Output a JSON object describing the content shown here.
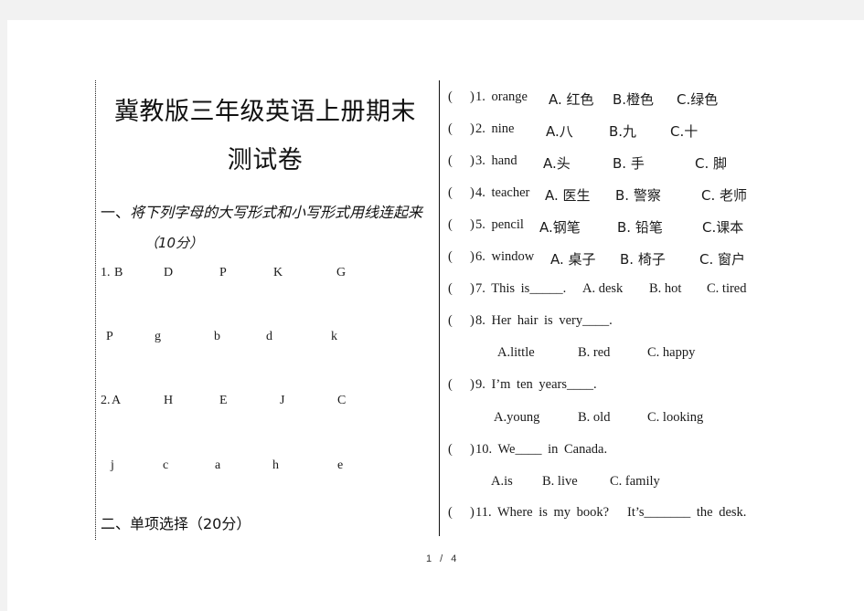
{
  "document": {
    "title_line1": "冀教版三年级英语上册期末",
    "title_line2": "测试卷",
    "section1": {
      "prefix": "一、",
      "instruction": "将下列字母的大写形式和小写形式用线连起来",
      "score": "（10分）",
      "rows": [
        {
          "label": "1.",
          "letters": [
            "B",
            "D",
            "P",
            "K",
            "G"
          ]
        },
        {
          "label": "",
          "letters": [
            "P",
            "g",
            "b",
            "d",
            "k"
          ]
        },
        {
          "label": "2.",
          "letters": [
            "A",
            "H",
            "E",
            "J",
            "C"
          ]
        },
        {
          "label": "",
          "letters": [
            "j",
            "c",
            "a",
            "h",
            "e"
          ]
        }
      ]
    },
    "section2": {
      "heading": "二、单项选择（20分）"
    },
    "questions": [
      {
        "num": "1.",
        "stem": "orange",
        "options": [
          "A. 红色",
          "B.橙色",
          "C.绿色"
        ]
      },
      {
        "num": "2.",
        "stem": "nine",
        "options": [
          "A.八",
          "B.九",
          "C.十"
        ]
      },
      {
        "num": "3.",
        "stem": "hand",
        "options": [
          "A.头",
          "B. 手",
          "C. 脚"
        ]
      },
      {
        "num": "4.",
        "stem": "teacher",
        "options": [
          "A. 医生",
          "B. 警察",
          "C. 老师"
        ]
      },
      {
        "num": "5.",
        "stem": "pencil",
        "options": [
          "A.钢笔",
          "B. 铅笔",
          "C.课本"
        ]
      },
      {
        "num": "6.",
        "stem": "window",
        "options": [
          "A. 桌子",
          "B. 椅子",
          "C. 窗户"
        ]
      },
      {
        "num": "7.",
        "stem": "This is_____.",
        "options": [
          "A. desk",
          "B. hot",
          "C. tired"
        ]
      },
      {
        "num": "8.",
        "stem": "Her hair is very____.",
        "options": [
          "A.little",
          "B. red",
          "C. happy"
        ]
      },
      {
        "num": "9.",
        "stem": "I’m ten years____.",
        "options": [
          "A.young",
          "B. old",
          "C. looking"
        ]
      },
      {
        "num": "10.",
        "stem": "We____ in Canada.",
        "options": [
          "A.is",
          "B. live",
          "C. family"
        ]
      },
      {
        "num": "11.",
        "stem": "Where is my book?   It’s_______ the desk.",
        "options": []
      }
    ],
    "paren_open": "(",
    "paren_close": ")",
    "page_indicator": "1 / 4"
  }
}
